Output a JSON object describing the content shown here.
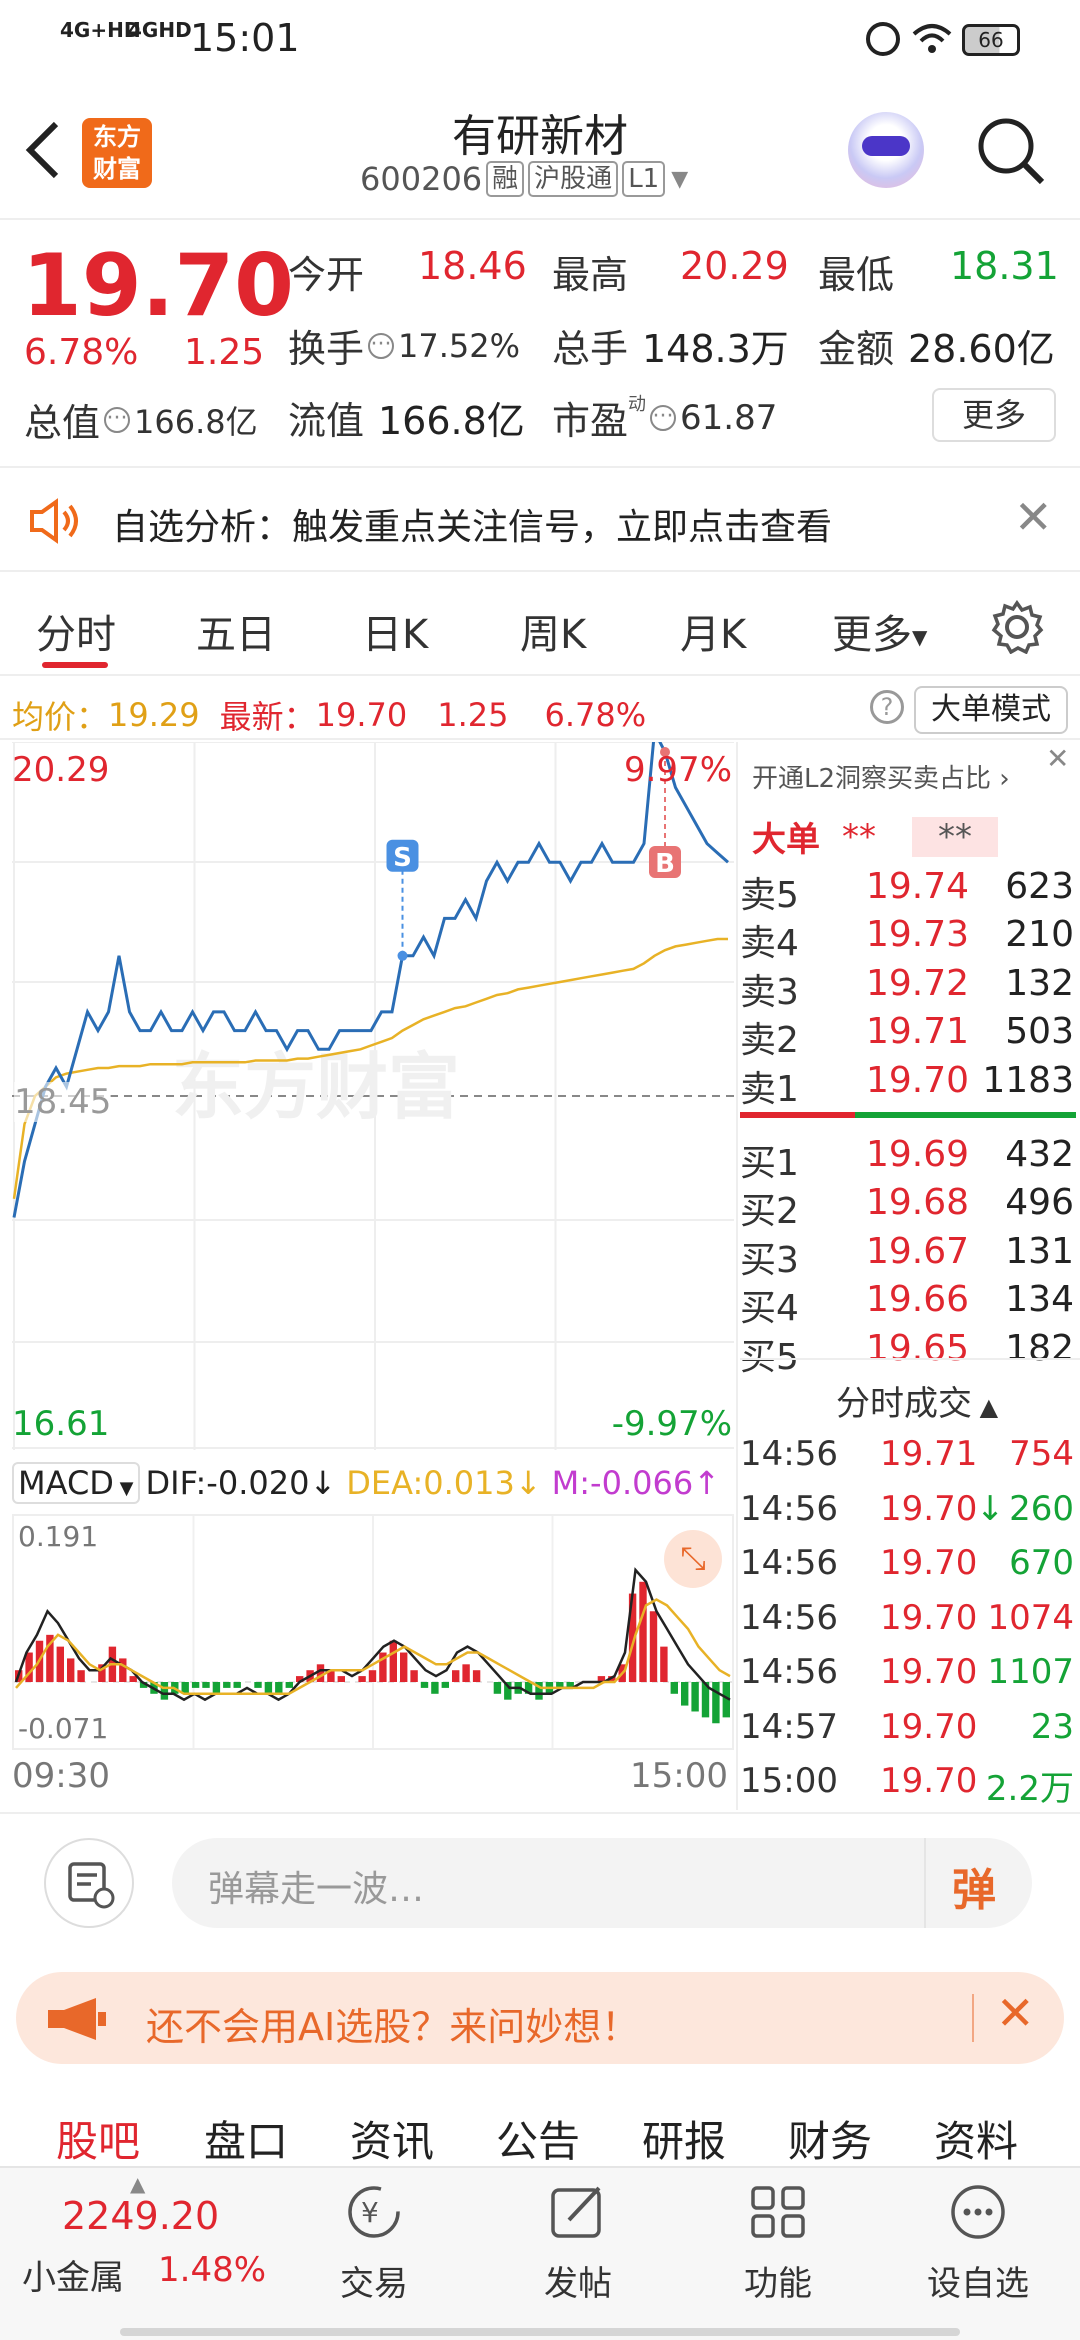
{
  "status_bar": {
    "signal1": "4G+HD",
    "signal2": "4GHD",
    "time": "15:01",
    "battery": "66"
  },
  "header": {
    "logo_line1": "东方",
    "logo_line2": "财富",
    "stock_name": "有研新材",
    "stock_code": "600206",
    "tags": [
      "融",
      "沪股通",
      "L1"
    ]
  },
  "quote": {
    "price": "19.70",
    "change_pct": "6.78%",
    "change": "1.25",
    "open_label": "今开",
    "open": "18.46",
    "high_label": "最高",
    "high": "20.29",
    "low_label": "最低",
    "low": "18.31",
    "turnover_label": "换手",
    "turnover": "17.52%",
    "volume_label": "总手",
    "volume": "148.3万",
    "amount_label": "金额",
    "amount": "28.60亿",
    "mktcap_label": "总值",
    "mktcap": "166.8亿",
    "float_label": "流值",
    "float": "166.8亿",
    "pe_label": "市盈",
    "pe_sup": "动",
    "pe": "61.87",
    "more_button": "更多"
  },
  "banner": {
    "text": "自选分析：触发重点关注信号，立即点击查看"
  },
  "tabs": [
    "分时",
    "五日",
    "日K",
    "周K",
    "月K",
    "更多"
  ],
  "info_line": {
    "avg_label": "均价：",
    "avg": "19.29",
    "latest_label": "最新：",
    "latest": "19.70",
    "change": "1.25",
    "change_pct": "6.78%",
    "mode_button": "大单模式"
  },
  "chart_data": {
    "type": "line",
    "x_start": "09:30",
    "x_end": "15:00",
    "ylim": [
      16.61,
      20.29
    ],
    "prev_close": "18.45",
    "y_top_label": "20.29",
    "y_bottom_label": "16.61",
    "pct_top_label": "9.97%",
    "pct_bottom_label": "-9.97%",
    "watermark": "东方财富",
    "markers": [
      "S",
      "B"
    ],
    "series": [
      {
        "values": [
          17.8,
          18.1,
          18.3,
          18.5,
          18.6,
          18.5,
          18.7,
          18.9,
          18.8,
          18.9,
          19.2,
          18.9,
          18.8,
          18.8,
          18.9,
          18.8,
          18.8,
          18.9,
          18.8,
          18.9,
          18.9,
          18.8,
          18.8,
          18.9,
          18.8,
          18.8,
          18.7,
          18.8,
          18.8,
          18.7,
          18.7,
          18.8,
          18.8,
          18.8,
          18.8,
          18.9,
          18.9,
          19.2,
          19.2,
          19.3,
          19.2,
          19.4,
          19.4,
          19.5,
          19.4,
          19.6,
          19.7,
          19.6,
          19.7,
          19.7,
          19.8,
          19.7,
          19.7,
          19.6,
          19.7,
          19.7,
          19.8,
          19.7,
          19.7,
          19.7,
          19.8,
          20.4,
          20.29,
          20.1,
          20.0,
          19.9,
          19.8,
          19.75,
          19.7
        ]
      },
      {
        "values": [
          17.9,
          18.3,
          18.45,
          18.5,
          18.55,
          18.57,
          18.58,
          18.59,
          18.6,
          18.6,
          18.61,
          18.61,
          18.61,
          18.62,
          18.62,
          18.62,
          18.62,
          18.63,
          18.63,
          18.63,
          18.63,
          18.63,
          18.63,
          18.64,
          18.64,
          18.64,
          18.64,
          18.65,
          18.65,
          18.66,
          18.67,
          18.68,
          18.69,
          18.7,
          18.72,
          18.74,
          18.76,
          18.8,
          18.83,
          18.86,
          18.88,
          18.9,
          18.92,
          18.93,
          18.95,
          18.97,
          18.99,
          19.0,
          19.02,
          19.03,
          19.04,
          19.05,
          19.06,
          19.07,
          19.08,
          19.09,
          19.1,
          19.11,
          19.12,
          19.13,
          19.16,
          19.2,
          19.23,
          19.25,
          19.26,
          19.27,
          19.28,
          19.29,
          19.29
        ]
      }
    ]
  },
  "macd": {
    "label": "MACD",
    "dif_label": "DIF:",
    "dif": "-0.020",
    "dea_label": "DEA:",
    "dea": "0.013",
    "m_label": "M:",
    "m": "-0.066",
    "top": "0.191",
    "bottom": "-0.071"
  },
  "orderbook": {
    "title": "开通L2洞察买卖占比",
    "big_label": "大单",
    "big_v1": "**",
    "big_v2": "**",
    "asks": [
      {
        "label": "卖5",
        "price": "19.74",
        "vol": "623"
      },
      {
        "label": "卖4",
        "price": "19.73",
        "vol": "210"
      },
      {
        "label": "卖3",
        "price": "19.72",
        "vol": "132"
      },
      {
        "label": "卖2",
        "price": "19.71",
        "vol": "503"
      },
      {
        "label": "卖1",
        "price": "19.70",
        "vol": "1183"
      }
    ],
    "bids": [
      {
        "label": "买1",
        "price": "19.69",
        "vol": "432"
      },
      {
        "label": "买2",
        "price": "19.68",
        "vol": "496"
      },
      {
        "label": "买3",
        "price": "19.67",
        "vol": "131"
      },
      {
        "label": "买4",
        "price": "19.66",
        "vol": "134"
      },
      {
        "label": "买5",
        "price": "19.65",
        "vol": "182"
      }
    ],
    "ticks_title": "分时成交",
    "ticks": [
      {
        "time": "14:56",
        "price": "19.71",
        "vol": "754",
        "arrow": ""
      },
      {
        "time": "14:56",
        "price": "19.70",
        "vol": "260",
        "arrow": "↓"
      },
      {
        "time": "14:56",
        "price": "19.70",
        "vol": "670",
        "arrow": ""
      },
      {
        "time": "14:56",
        "price": "19.70",
        "vol": "1074",
        "arrow": ""
      },
      {
        "time": "14:56",
        "price": "19.70",
        "vol": "1107",
        "arrow": ""
      },
      {
        "time": "14:57",
        "price": "19.70",
        "vol": "23",
        "arrow": ""
      },
      {
        "time": "15:00",
        "price": "19.70",
        "vol": "2.2万",
        "arrow": ""
      }
    ]
  },
  "comment": {
    "placeholder": "弹幕走一波…",
    "send": "弹"
  },
  "ai_banner": {
    "text": "还不会用AI选股？来问妙想！"
  },
  "section_tabs": [
    "股吧",
    "盘口",
    "资讯",
    "公告",
    "研报",
    "财务",
    "资料"
  ],
  "bottom_bar": {
    "index_value": "2249.20",
    "index_name": "小金属",
    "index_pct": "1.48%",
    "items": [
      "交易",
      "发帖",
      "功能",
      "设自选"
    ]
  }
}
